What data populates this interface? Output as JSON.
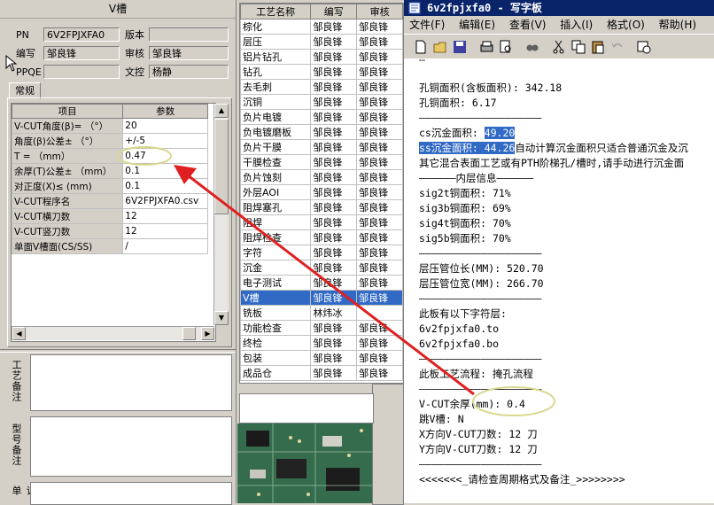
{
  "left": {
    "title": "V槽",
    "pn_label": "PN",
    "pn_value": "6V2FPJXFA0",
    "version_label": "版本",
    "version_value": "",
    "author_label": "编写",
    "author_value": "邹良锋",
    "reviewer_label": "审核",
    "reviewer_value": "邹良锋",
    "ppqe_label": "PPQE",
    "ppqe_value": "",
    "doc_control_label": "文控",
    "doc_control_value": "杨静",
    "tab_label": "常规",
    "grid_headers": [
      "项目",
      "参数"
    ],
    "grid_rows": [
      [
        "V-CUT角度(β)= （°）",
        "20"
      ],
      [
        "角度(β)公差± （°）",
        "+/-5"
      ],
      [
        "T = （mm）",
        "0.47"
      ],
      [
        "余厚(T)公差± （mm）",
        "0.1"
      ],
      [
        "对正度(X)≤ (mm)",
        "0.1"
      ],
      [
        "V-CUT程序名",
        "6V2FPJXFA0.csv"
      ],
      [
        "V-CUT横刀数",
        "12"
      ],
      [
        "V-CUT竖刀数",
        "12"
      ],
      [
        "单面V槽面(CS/SS)",
        "/"
      ]
    ],
    "side_labels": [
      "工艺备注",
      "型号备注",
      "订单"
    ]
  },
  "process": {
    "headers": [
      "工艺名称",
      "编写",
      "审核"
    ],
    "rows": [
      [
        "棕化",
        "邹良锋",
        "邹良锋"
      ],
      [
        "层压",
        "邹良锋",
        "邹良锋"
      ],
      [
        "铝片钻孔",
        "邹良锋",
        "邹良锋"
      ],
      [
        "钻孔",
        "邹良锋",
        "邹良锋"
      ],
      [
        "去毛刺",
        "邹良锋",
        "邹良锋"
      ],
      [
        "沉铜",
        "邹良锋",
        "邹良锋"
      ],
      [
        "负片电镀",
        "邹良锋",
        "邹良锋"
      ],
      [
        "负电镀磨板",
        "邹良锋",
        "邹良锋"
      ],
      [
        "负片干膜",
        "邹良锋",
        "邹良锋"
      ],
      [
        "干膜检查",
        "邹良锋",
        "邹良锋"
      ],
      [
        "负片蚀刻",
        "邹良锋",
        "邹良锋"
      ],
      [
        "外层AOI",
        "邹良锋",
        "邹良锋"
      ],
      [
        "阻焊塞孔",
        "邹良锋",
        "邹良锋"
      ],
      [
        "阻焊",
        "邹良锋",
        "邹良锋"
      ],
      [
        "阻焊检查",
        "邹良锋",
        "邹良锋"
      ],
      [
        "字符",
        "邹良锋",
        "邹良锋"
      ],
      [
        "沉金",
        "邹良锋",
        "邹良锋"
      ],
      [
        "电子测试",
        "邹良锋",
        "邹良锋"
      ],
      [
        "V槽",
        "邹良锋",
        "邹良锋"
      ],
      [
        "铣板",
        "林炜冰",
        ""
      ],
      [
        "功能检查",
        "邹良锋",
        "邹良锋"
      ],
      [
        "终检",
        "邹良锋",
        "邹良锋"
      ],
      [
        "包装",
        "邹良锋",
        "邹良锋"
      ],
      [
        "成品仓",
        "邹良锋",
        "邹良锋"
      ]
    ],
    "selected_index": 18
  },
  "notepad": {
    "title": "6v2fpjxfa0 - 写字板",
    "menu": [
      "文件(F)",
      "编辑(E)",
      "查看(V)",
      "插入(I)",
      "格式(O)",
      "帮助(H)"
    ],
    "lines": [
      "孔铜面积(含板面积): 342.18",
      "孔铜面积: 6.17",
      "————————————————————",
      "cs沉金面积: 49.20",
      "ss沉金面积: 44.26自动计算沉金面积只适合普通沉金及沉",
      "其它混合表面工艺或有PTH阶梯孔/槽时,请手动进行沉金面",
      "——————内层信息——————",
      "sig2t铜面积: 71%",
      "sig3b铜面积: 69%",
      "sig4t铜面积: 70%",
      "sig5b铜面积: 70%",
      "————————————————————",
      "层压管位长(MM): 520.70",
      "层压管位宽(MM): 266.70",
      "————————————————————",
      "此板有以下字符层:",
      "6v2fpjxfa0.to",
      "6v2fpjxfa0.bo",
      "————————————————————",
      "此板工艺流程: 掩孔流程",
      "————————————————————",
      "V-CUT余厚(mm): 0.4",
      "跳V槽: N",
      "X方向V-CUT刀数: 12 刀",
      "Y方向V-CUT刀数: 12 刀",
      "————————————————————",
      "<<<<<<<_请检查周期格式及备注_>>>>>>>>"
    ],
    "highlight_cs": "49.20",
    "highlight_ss": "ss沉金面积: 44.26"
  }
}
